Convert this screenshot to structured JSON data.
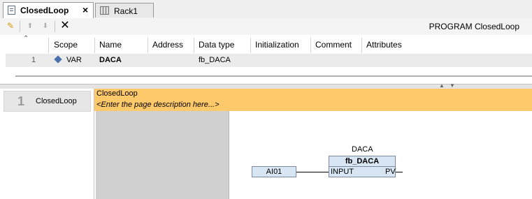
{
  "tabs": [
    {
      "label": "ClosedLoop",
      "active": true,
      "icon": "pou-document-icon"
    },
    {
      "label": "Rack1",
      "active": false,
      "icon": "rack-icon"
    }
  ],
  "toolbar": {
    "title": "PROGRAM ClosedLoop",
    "buttons": [
      "auto-declare-icon",
      "move-up-icon",
      "move-down-icon",
      "delete-icon"
    ]
  },
  "declarations": {
    "columns": [
      "Scope",
      "Name",
      "Address",
      "Data type",
      "Initialization",
      "Comment",
      "Attributes"
    ],
    "rows": [
      {
        "line": "1",
        "scope": "VAR",
        "name": "DACA",
        "address": "",
        "data_type": "fb_DACA",
        "initialization": "",
        "comment": "",
        "attributes": ""
      }
    ]
  },
  "network": {
    "number": "1",
    "title": "ClosedLoop",
    "comment": "<Enter the page description here...>",
    "fb": {
      "instance": "DACA",
      "type": "fb_DACA",
      "input_pin": "INPUT",
      "output_pin": "PV",
      "input_var": "AI01"
    }
  },
  "colors": {
    "accent_orange": "#fdc96b",
    "fb_fill": "#d8e6f4"
  }
}
